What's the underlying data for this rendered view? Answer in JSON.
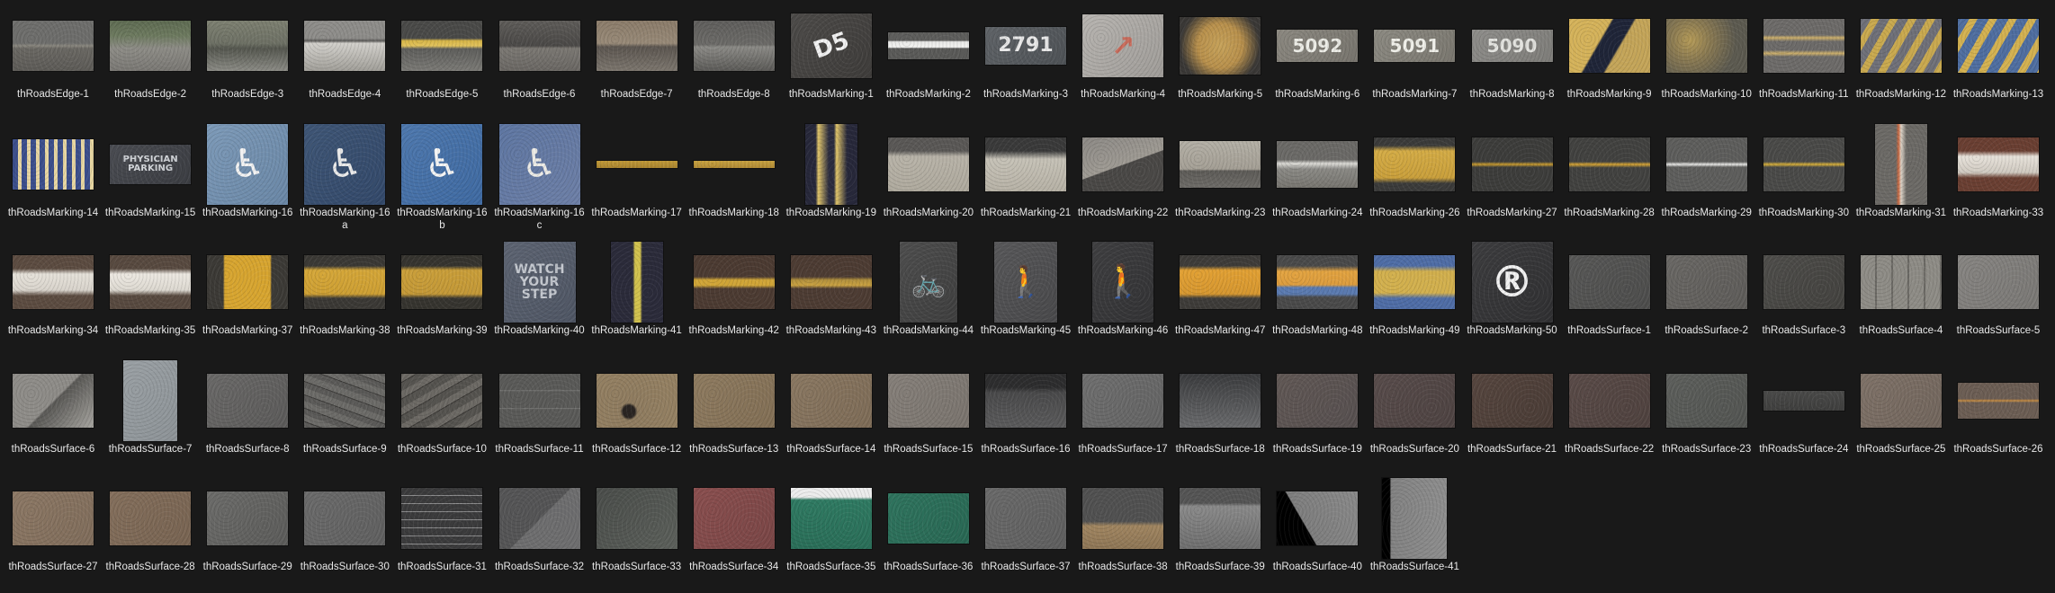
{
  "items": [
    {
      "label": "thRoadsEdge-1",
      "thumb": "asphalt-curb-edge",
      "fill": "linear-gradient(180deg,#6e6e6c 0%,#6e6e6c 45%,#8a877f 50%,#6a6863 55%,#5d5b57 100%)"
    },
    {
      "label": "thRoadsEdge-2",
      "thumb": "grass-curb-edge",
      "fill": "linear-gradient(180deg,#5e6b52 0%,#6d7a5f 30%,#8d8c86 55%,#7a7874 100%)"
    },
    {
      "label": "thRoadsEdge-3",
      "thumb": "stone-curb-edge",
      "fill": "linear-gradient(180deg,#7d8071 0%,#6e7165 45%,#55574f 55%,#8b8b85 100%)"
    },
    {
      "label": "thRoadsEdge-4",
      "thumb": "concrete-curb-edge",
      "fill": "linear-gradient(180deg,#8e8d8a 0%,#8e8d8a 35%,#5b5a58 40%,#d2d0cb 45%,#a09e98 100%)"
    },
    {
      "label": "thRoadsEdge-5",
      "thumb": "yellow-curb-edge",
      "fill": "linear-gradient(180deg,#4a4a48 0%,#4a4a48 35%,#d6b548 40%,#e2c35c 50%,#5e5e5b 56%,#7b7a76 100%)"
    },
    {
      "label": "thRoadsEdge-6",
      "thumb": "dark-curb-edge",
      "fill": "linear-gradient(180deg,#5e5c59 0%,#4b4947 50%,#7b7873 55%,#6a6763 100%)"
    },
    {
      "label": "thRoadsEdge-7",
      "thumb": "brown-curb-edge",
      "fill": "linear-gradient(180deg,#8b7c6a 0%,#988a78 45%,#5c5650 52%,#7c766e 100%)"
    },
    {
      "label": "thRoadsEdge-8",
      "thumb": "gray-curb-edge",
      "fill": "linear-gradient(180deg,#5f5e5c 0%,#6c6b68 48%,#8b8a86 52%,#5b5a57 100%)"
    },
    {
      "label": "thRoadsMarking-1",
      "thumb": "painted-number-marking",
      "fill": "linear-gradient(135deg,#4d4b49,#3e3c3a)",
      "text": "D5",
      "textColor": "#f1f1f1",
      "textSize": "26px",
      "rot": "-20deg"
    },
    {
      "label": "thRoadsMarking-2",
      "thumb": "white-line-marking",
      "fill": "linear-gradient(180deg,#5e5e5c 0%,#5e5e5c 30%,#e8e8e6 35%,#f2f2f0 55%,#5a5a58 60%,#5a5a58 100%)"
    },
    {
      "label": "thRoadsMarking-3",
      "thumb": "number-2791-marking",
      "fill": "linear-gradient(135deg,#5f6367,#4e5256)",
      "text": "2791",
      "textColor": "#eaeaea",
      "textSize": "22px"
    },
    {
      "label": "thRoadsMarking-4",
      "thumb": "arrow-marking",
      "fill": "linear-gradient(135deg,#b7b4b0,#9f9c98)",
      "text": "↗",
      "textColor": "#c86b5b",
      "textSize": "32px"
    },
    {
      "label": "thRoadsMarking-5",
      "thumb": "yellow-patch-marking",
      "fill": "radial-gradient(circle at 50% 50%,#c6a25a 0,#b8904c 45%,#3a3836 80%)"
    },
    {
      "label": "thRoadsMarking-6",
      "thumb": "number-5092-marking",
      "fill": "linear-gradient(135deg,#8b8880,#77746d)",
      "text": "5092",
      "textColor": "#ecece6",
      "textSize": "20px"
    },
    {
      "label": "thRoadsMarking-7",
      "thumb": "number-5091-marking",
      "fill": "linear-gradient(135deg,#8c8a82,#7a776f)",
      "text": "5091",
      "textColor": "#efefe9",
      "textSize": "20px"
    },
    {
      "label": "thRoadsMarking-8",
      "thumb": "number-5090-marking",
      "fill": "linear-gradient(135deg,#8e8d8a,#7e7d79)",
      "text": "5090",
      "textColor": "#e3e3df",
      "textSize": "20px"
    },
    {
      "label": "thRoadsMarking-9",
      "thumb": "diagonal-stripe-marking",
      "fill": "linear-gradient(120deg,#d4b25a 0%,#d4b25a 38%,#1f2538 40%,#1f2538 58%,#c4a559 60%,#c4a559 100%)"
    },
    {
      "label": "thRoadsMarking-10",
      "thumb": "worn-yellow-marking",
      "fill": "radial-gradient(circle at 30% 40%,#b49a57 0,#8a7a52 30%,#5c5a50 70%)"
    },
    {
      "label": "thRoadsMarking-11",
      "thumb": "yellow-lines-marking",
      "fill": "linear-gradient(180deg,#6d6b69 0%,#6d6b69 30%,#cdb06b 35%,#6d6b69 42%,#6d6b69 58%,#cdb06b 64%,#6d6b69 70%,#6d6b69 100%)"
    },
    {
      "label": "thRoadsMarking-12",
      "thumb": "hatched-yellow-marking",
      "fill": "repeating-linear-gradient(120deg,#6f7078 0 10px,#c9a94f 10px 18px)"
    },
    {
      "label": "thRoadsMarking-13",
      "thumb": "hatched-blue-yellow-marking",
      "fill": "repeating-linear-gradient(120deg,#4f6ea0 0 11px,#d3b151 11px 19px)"
    },
    {
      "label": "thRoadsMarking-14",
      "thumb": "crosswalk-marking",
      "fill": "repeating-linear-gradient(90deg,#3c4f8c 0 6px,#e7d6a2 6px 10px)"
    },
    {
      "label": "thRoadsMarking-15",
      "thumb": "physician-parking-marking",
      "fill": "linear-gradient(135deg,#4a4c52,#3b3d42)",
      "text": "PHYSICIAN\nPARKING",
      "textColor": "#d3d6da",
      "textSize": "10px"
    },
    {
      "label": "thRoadsMarking-16",
      "thumb": "handicap-blue-marking",
      "fill": "linear-gradient(135deg,#7d9ab8,#6a87a6)",
      "text": "♿",
      "textColor": "#f2f2f2",
      "textSize": "44px"
    },
    {
      "label": "thRoadsMarking-16a",
      "thumb": "handicap-dark-marking",
      "fill": "linear-gradient(135deg,#3f5676,#33496a)",
      "text": "♿",
      "textColor": "#eaeaea",
      "textSize": "44px"
    },
    {
      "label": "thRoadsMarking-16b",
      "thumb": "handicap-blue-worn-marking",
      "fill": "linear-gradient(135deg,#4e78ad,#3f6aa2)",
      "text": "♿",
      "textColor": "#f4f4f4",
      "textSize": "44px"
    },
    {
      "label": "thRoadsMarking-16c",
      "thumb": "handicap-faded-marking",
      "fill": "linear-gradient(135deg,#5e76a2,#6d7fa6)",
      "text": "♿",
      "textColor": "#ecebe6",
      "textSize": "44px"
    },
    {
      "label": "thRoadsMarking-17",
      "thumb": "thin-yellow-strip-marking",
      "fill": "linear-gradient(180deg,#c19a38,#a98430)"
    },
    {
      "label": "thRoadsMarking-18",
      "thumb": "thin-yellow-strip2-marking",
      "fill": "linear-gradient(180deg,#c8a240,#b18a35)"
    },
    {
      "label": "thRoadsMarking-19",
      "thumb": "vertical-yellow-marking",
      "fill": "linear-gradient(90deg,#27283a 0%,#27283a 20%,#e1c56a 25%,#2b2c3e 45%,#2b2c3e 55%,#e1c56a 60%,#27283a 80%,#27283a 100%)"
    },
    {
      "label": "thRoadsMarking-20",
      "thumb": "concrete-ramp-marking",
      "fill": "linear-gradient(180deg,#5a5856 0%,#5a5856 25%,#b8b3a8 35%,#aea99d 100%)"
    },
    {
      "label": "thRoadsMarking-21",
      "thumb": "ramp-edge-marking",
      "fill": "linear-gradient(180deg,#3a3a3a 0%,#3a3a3a 25%,#c6c2b7 40%,#b6b1a5 100%)"
    },
    {
      "label": "thRoadsMarking-22",
      "thumb": "diagonal-edge-marking",
      "fill": "linear-gradient(160deg,#8b8884 0%,#9e9a93 50%,#4a4846 51%,#4a4846 100%)"
    },
    {
      "label": "thRoadsMarking-23",
      "thumb": "light-curb-marking",
      "fill": "linear-gradient(180deg,#b4b0a6 0%,#a49f95 60%,#5d5b57 64%,#6e6c68 100%)"
    },
    {
      "label": "thRoadsMarking-24",
      "thumb": "white-patch-marking",
      "fill": "linear-gradient(180deg,#6b6a67 0%,#6b6a67 40%,#dcdbd6 48%,#8a8985 60%,#77756f 100%)"
    },
    {
      "label": "thRoadsMarking-26",
      "thumb": "yellow-cracked-marking",
      "fill": "linear-gradient(180deg,#3b3b3a 0%,#3b3b3a 15%,#d4ac46 25%,#c99f3b 75%,#3b3b3a 85%,#3b3b3a 100%)"
    },
    {
      "label": "thRoadsMarking-27",
      "thumb": "asphalt-yellow-line-marking",
      "fill": "linear-gradient(180deg,#3d3d3b 0%,#3d3d3b 45%,#c89b2f 50%,#3d3d3b 55%,#3d3d3b 100%)"
    },
    {
      "label": "thRoadsMarking-28",
      "thumb": "asphalt-orange-line-marking",
      "fill": "linear-gradient(180deg,#424240 0%,#424240 45%,#d4a334 50%,#424240 56%,#424240 100%)"
    },
    {
      "label": "thRoadsMarking-29",
      "thumb": "asphalt-white-line-marking",
      "fill": "linear-gradient(180deg,#5e5e5c 0%,#5e5e5c 45%,#e8e8e6 50%,#5e5e5c 55%,#5e5e5c 100%)"
    },
    {
      "label": "thRoadsMarking-30",
      "thumb": "asphalt-yellow-line2-marking",
      "fill": "linear-gradient(180deg,#4a4a48 0%,#4a4a48 45%,#d5ae3a 50%,#4a4a48 55%,#4a4a48 100%)"
    },
    {
      "label": "thRoadsMarking-31",
      "thumb": "vertical-red-line-marking",
      "fill": "linear-gradient(90deg,#6c6a66 0%,#6c6a66 40%,#c9673f 45%,#dcd3c7 50%,#6c6a66 60%,#6c6a66 100%)"
    },
    {
      "label": "thRoadsMarking-33",
      "thumb": "white-red-band-marking",
      "fill": "linear-gradient(180deg,#6a3f32 0%,#6a3f32 25%,#e7e2da 35%,#cfc9c0 65%,#6a3f32 75%,#6a3f32 100%)"
    },
    {
      "label": "thRoadsMarking-34",
      "thumb": "white-band-marking",
      "fill": "linear-gradient(180deg,#5c4c41 0%,#5c4c41 25%,#e5e1d9 35%,#d8d3cb 65%,#5c4c41 75%,#5c4c41 100%)"
    },
    {
      "label": "thRoadsMarking-35",
      "thumb": "white-band2-marking",
      "fill": "linear-gradient(180deg,#584a40 0%,#584a40 25%,#ece8e1 35%,#dcd8d0 65%,#584a40 75%,#584a40 100%)"
    },
    {
      "label": "thRoadsMarking-37",
      "thumb": "yellow-cross-marking",
      "fill": "linear-gradient(90deg,#3c3a36 0%,#3c3a36 20%,#d7a530 22%,#d7a530 78%,#3c3a36 80%,#3c3a36 100%)"
    },
    {
      "label": "thRoadsMarking-38",
      "thumb": "yellow-band-marking",
      "fill": "linear-gradient(180deg,#3b3935 0%,#3b3935 20%,#d5a739 28%,#cd9f33 72%,#3b3935 80%,#3b3935 100%)"
    },
    {
      "label": "thRoadsMarking-39",
      "thumb": "yellow-cracked-band-marking",
      "fill": "linear-gradient(180deg,#36342f 0%,#36342f 20%,#ca9f3a 28%,#c39837 72%,#36342f 80%,#36342f 100%)"
    },
    {
      "label": "thRoadsMarking-40",
      "thumb": "watch-your-step-marking",
      "fill": "linear-gradient(135deg,#5d6472,#4f5664)",
      "text": "WATCH\nYOUR\nSTEP",
      "textColor": "#c3c7ce",
      "textSize": "14px"
    },
    {
      "label": "thRoadsMarking-41",
      "thumb": "vertical-yellow-stripe-marking",
      "fill": "linear-gradient(90deg,#2b2b3a 0%,#2b2b3a 42%,#d2c24e 46%,#d2c24e 56%,#2b2b3a 60%,#2b2b3a 100%)"
    },
    {
      "label": "thRoadsMarking-42",
      "thumb": "brown-yellow-stripe-marking",
      "fill": "linear-gradient(180deg,#4c3b32 0%,#4c3b32 40%,#d0a537 46%,#d0a537 56%,#4c3b32 62%,#4c3b32 100%)"
    },
    {
      "label": "thRoadsMarking-43",
      "thumb": "brown-yellow-worn-marking",
      "fill": "linear-gradient(180deg,#4d3c33 0%,#4d3c33 40%,#b08f3c 46%,#c9a141 56%,#4d3c33 62%,#4d3c33 100%)"
    },
    {
      "label": "thRoadsMarking-44",
      "thumb": "bicycle-marking",
      "fill": "linear-gradient(135deg,#4e4e4e,#3f3f3f)",
      "text": "🚲",
      "textColor": "#e5e5e5",
      "textSize": "32px"
    },
    {
      "label": "thRoadsMarking-45",
      "thumb": "pedestrian-marking",
      "fill": "linear-gradient(135deg,#58585a,#49494b)",
      "text": "🚶",
      "textColor": "#e8e8e8",
      "textSize": "34px"
    },
    {
      "label": "thRoadsMarking-46",
      "thumb": "pedestrian-white-marking",
      "fill": "linear-gradient(135deg,#3f3f41,#333335)",
      "text": "🚶",
      "textColor": "#f2f2f2",
      "textSize": "36px"
    },
    {
      "label": "thRoadsMarking-47",
      "thumb": "orange-cracked-marking",
      "fill": "linear-gradient(180deg,#3e3c39 0%,#3e3c39 20%,#e2a134 28%,#d69730 72%,#3e3c39 80%,#3e3c39 100%)"
    },
    {
      "label": "thRoadsMarking-48",
      "thumb": "orange-blue-marking",
      "fill": "linear-gradient(180deg,#4a4a4a 0%,#4a4a4a 20%,#e3a441 30%,#dc9c3d 55%,#5a7ab0 60%,#5a7ab0 72%,#4a4a4a 78%,#4a4a4a 100%)"
    },
    {
      "label": "thRoadsMarking-49",
      "thumb": "blue-yellow-stripe-marking",
      "fill": "linear-gradient(180deg,#4f6da6 0%,#4f6da6 20%,#d2b04e 30%,#d2b04e 70%,#4f6da6 80%,#4f6da6 100%)"
    },
    {
      "label": "thRoadsMarking-50",
      "thumb": "registered-symbol-marking",
      "fill": "linear-gradient(135deg,#3d3d3f,#303032)",
      "text": "®",
      "textColor": "#f2f2f2",
      "textSize": "48px"
    },
    {
      "label": "thRoadsSurface-1",
      "thumb": "asphalt-surface",
      "fill": "linear-gradient(135deg,#585857,#4d4d4c)"
    },
    {
      "label": "thRoadsSurface-2",
      "thumb": "gray-asphalt-surface",
      "fill": "linear-gradient(135deg,#6a6865,#5e5c59)"
    },
    {
      "label": "thRoadsSurface-3",
      "thumb": "gravel-surface",
      "fill": "linear-gradient(135deg,#4f4e4b,#43423f)"
    },
    {
      "label": "thRoadsSurface-4",
      "thumb": "concrete-slab-surface",
      "fill": "repeating-linear-gradient(90deg,#8e8c86 0 16px,#6c6a65 16px 18px)"
    },
    {
      "label": "thRoadsSurface-5",
      "thumb": "light-concrete-surface",
      "fill": "linear-gradient(135deg,#878582,#7a7875)"
    },
    {
      "label": "thRoadsSurface-6",
      "thumb": "broken-concrete-surface",
      "fill": "linear-gradient(135deg,#8e8c88 0%,#8e8c88 50%,#5a5956 52%,#a7a5a0 100%)"
    },
    {
      "label": "thRoadsSurface-7",
      "thumb": "cracked-concrete-surface",
      "fill": "linear-gradient(135deg,#9aa0a4,#8d9397)"
    },
    {
      "label": "thRoadsSurface-8",
      "thumb": "rough-asphalt-surface",
      "fill": "linear-gradient(135deg,#6a6968,#5c5b5a)"
    },
    {
      "label": "thRoadsSurface-9",
      "thumb": "cracked-asphalt-surface",
      "fill": "repeating-linear-gradient(20deg,#5b5a58 0 6px,#3c3b39 6px 7px,#6c6b68 7px 14px)"
    },
    {
      "label": "thRoadsSurface-10",
      "thumb": "crumbled-asphalt-surface",
      "fill": "repeating-linear-gradient(-30deg,#55534f 0 8px,#3a3835 8px 9px,#6c6964 9px 16px)"
    },
    {
      "label": "thRoadsSurface-11",
      "thumb": "lane-dashes-surface",
      "fill": "linear-gradient(180deg,#5a5a58 0%,#5a5a58 30%,#7a7a78 31%,#5a5a58 33%,#5a5a58 63%,#7a7a78 64%,#5a5a58 66%,#5a5a58 100%)"
    },
    {
      "label": "thRoadsSurface-12",
      "thumb": "tan-surface-with-spot",
      "fill": "radial-gradient(circle at 40% 70%,#2a2522 0,#2a2522 10%,#8f7c60 14%,#968263 100%)"
    },
    {
      "label": "thRoadsSurface-13",
      "thumb": "tan-surface",
      "fill": "linear-gradient(135deg,#8e7b60,#826f55)"
    },
    {
      "label": "thRoadsSurface-14",
      "thumb": "tan-crack-surface",
      "fill": "linear-gradient(135deg,#8a7862,#7e6c57)"
    },
    {
      "label": "thRoadsSurface-15",
      "thumb": "light-tan-surface",
      "fill": "linear-gradient(135deg,#86807a,#7a746e)"
    },
    {
      "label": "thRoadsSurface-16",
      "thumb": "wet-asphalt-surface",
      "fill": "linear-gradient(180deg,#2d2d2e 0%,#2d2d2e 25%,#4a4a4b 35%,#5b5b5c 100%)"
    },
    {
      "label": "thRoadsSurface-17",
      "thumb": "smooth-gray-surface",
      "fill": "linear-gradient(135deg,#6f6f6f,#646464)"
    },
    {
      "label": "thRoadsSurface-18",
      "thumb": "dark-gravel-surface",
      "fill": "linear-gradient(180deg,#3a3b3d 0%,#4c4d4f 35%,#6a6b6d 100%)"
    },
    {
      "label": "thRoadsSurface-19",
      "thumb": "reddish-asphalt-surface",
      "fill": "linear-gradient(135deg,#615855,#575050)"
    },
    {
      "label": "thRoadsSurface-20",
      "thumb": "maroon-asphalt-surface",
      "fill": "linear-gradient(135deg,#584c4b,#4e4342)"
    },
    {
      "label": "thRoadsSurface-21",
      "thumb": "cracked-maroon-surface",
      "fill": "linear-gradient(135deg,#56463f,#4a3c36)"
    },
    {
      "label": "thRoadsSurface-22",
      "thumb": "maroon-smooth-surface",
      "fill": "linear-gradient(135deg,#5a4b48,#4f423f)"
    },
    {
      "label": "thRoadsSurface-23",
      "thumb": "gray-green-surface",
      "fill": "linear-gradient(135deg,#5d5f5c,#535552)"
    },
    {
      "label": "thRoadsSurface-24",
      "thumb": "thin-asphalt-strip-surface",
      "fill": "linear-gradient(180deg,#4a4a49,#3f3f3e)"
    },
    {
      "label": "thRoadsSurface-25",
      "thumb": "pitted-tan-surface",
      "fill": "linear-gradient(135deg,#7f7268,#72665d)"
    },
    {
      "label": "thRoadsSurface-26",
      "thumb": "tan-orange-line-surface",
      "fill": "linear-gradient(180deg,#6c5e54 0%,#6c5e54 45%,#c68c42 50%,#6c5e54 55%,#6c5e54 100%)"
    },
    {
      "label": "thRoadsSurface-27",
      "thumb": "sand-surface",
      "fill": "linear-gradient(135deg,#8c7865,#806d5b)"
    },
    {
      "label": "thRoadsSurface-28",
      "thumb": "sand-rough-surface",
      "fill": "linear-gradient(135deg,#846f5c,#786452)"
    },
    {
      "label": "thRoadsSurface-29",
      "thumb": "worn-gray-surface",
      "fill": "linear-gradient(135deg,#6c6c6a,#5c5c5a)"
    },
    {
      "label": "thRoadsSurface-30",
      "thumb": "flat-gray-surface",
      "fill": "linear-gradient(135deg,#6b6b6b,#606060)"
    },
    {
      "label": "thRoadsSurface-31",
      "thumb": "dark-striped-surface",
      "fill": "repeating-linear-gradient(180deg,#3b3b3c 0 8px,#8a8a8b 8px 9px)"
    },
    {
      "label": "thRoadsSurface-32",
      "thumb": "patched-gray-surface",
      "fill": "linear-gradient(135deg,#555556 0%,#555556 50%,#6e6e6f 51%,#6e6e6f 100%)"
    },
    {
      "label": "thRoadsSurface-33",
      "thumb": "aerial-road-surface",
      "fill": "linear-gradient(135deg,#4a4d4a,#5c605b)"
    },
    {
      "label": "thRoadsSurface-34",
      "thumb": "red-surface",
      "fill": "linear-gradient(135deg,#8a4f4f,#7a4646)"
    },
    {
      "label": "thRoadsSurface-35",
      "thumb": "green-white-surface",
      "fill": "linear-gradient(180deg,#ececec 0%,#ececec 15%,#2f7a62 20%,#2a6e58 100%)"
    },
    {
      "label": "thRoadsSurface-36",
      "thumb": "green-surface",
      "fill": "linear-gradient(135deg,#2f745e,#296854)"
    },
    {
      "label": "thRoadsSurface-37",
      "thumb": "medium-gray-surface",
      "fill": "linear-gradient(135deg,#6a6a6a,#5f5f5f)"
    },
    {
      "label": "thRoadsSurface-38",
      "thumb": "road-shoulder-surface",
      "fill": "linear-gradient(180deg,#515151 0%,#515151 55%,#a08560 62%,#8e7656 100%)"
    },
    {
      "label": "thRoadsSurface-39",
      "thumb": "road-with-cars-surface",
      "fill": "linear-gradient(180deg,#555 0%,#555 25%,#8a8a8a 30%,#6e6e6e 100%)"
    },
    {
      "label": "thRoadsSurface-40",
      "thumb": "cutout-concrete-surface",
      "fill": "linear-gradient(60deg,#000 0%,#000 35%,#7e7e7e 36%,#8a8a8a 100%)"
    },
    {
      "label": "thRoadsSurface-41",
      "thumb": "tall-concrete-surface",
      "fill": "linear-gradient(90deg,#000 0%,#000 12%,#828282 14%,#8e8e8e 100%)"
    }
  ]
}
